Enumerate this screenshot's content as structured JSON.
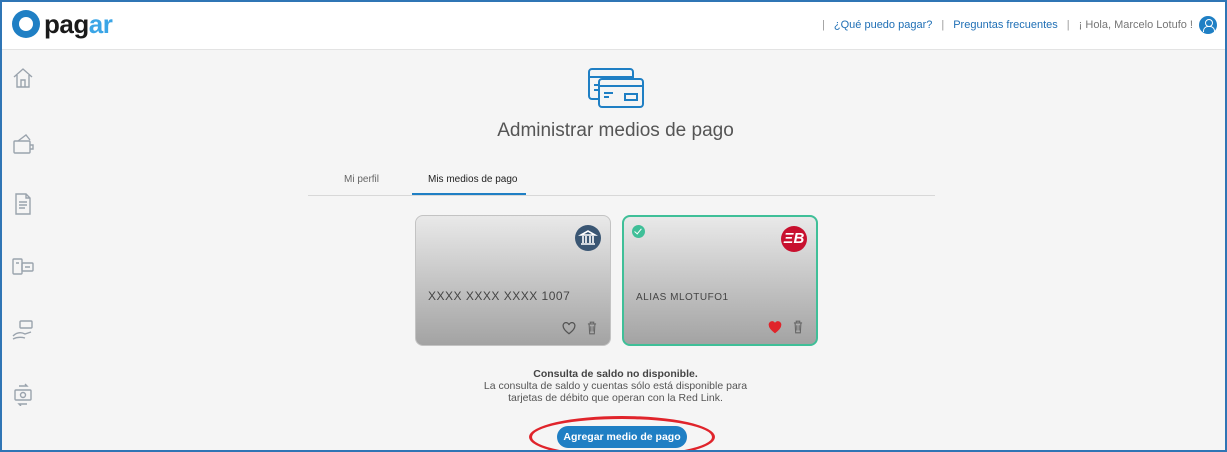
{
  "header": {
    "logo_text": "pag",
    "logo_text_accent": "ar",
    "links": [
      "¿Qué puedo pagar?",
      "Preguntas frecuentes"
    ],
    "greeting": "¡ Hola, Marcelo Lotufo !",
    "separator": "|"
  },
  "sidebar": {
    "icons": [
      "home-icon",
      "wallet-icon",
      "document-icon",
      "pay-services-icon",
      "send-money-icon",
      "exchange-icon"
    ]
  },
  "main": {
    "title": "Administrar medios de pago",
    "tabs": [
      {
        "label": "Mi perfil",
        "active": false
      },
      {
        "label": "Mis medios de pago",
        "active": true
      }
    ],
    "cards": [
      {
        "number": "XXXX XXXX XXXX 1007",
        "badge_icon": "bank-icon",
        "favorite": false,
        "selected": false
      },
      {
        "alias": "ALIAS MLOTUFO1",
        "badge_text": "ΞB",
        "badge_icon": "ebanx-icon",
        "favorite": true,
        "selected": true
      }
    ],
    "info_title": "Consulta de saldo no disponible.",
    "info_line1": "La consulta de saldo y cuentas sólo está disponible para",
    "info_line2": "tarjetas de débito que operan con la Red Link.",
    "cta_label": "Agregar medio de pago"
  },
  "colors": {
    "brand": "#1f7fc4",
    "selected_border": "#3fbf98",
    "favorite": "#e0242b",
    "annotation": "#e0242b"
  }
}
